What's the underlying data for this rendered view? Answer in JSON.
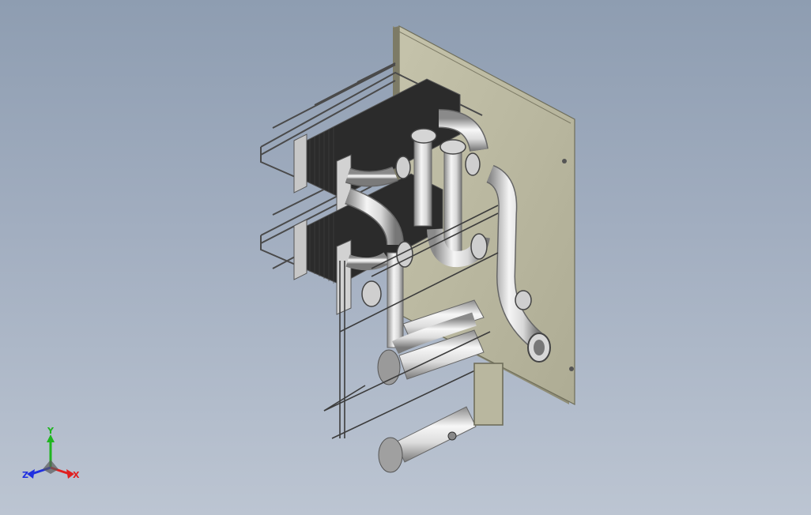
{
  "viewport": {
    "background_top": "#8e9db1",
    "background_bottom": "#bcc5d2"
  },
  "model": {
    "description_icon": "cad-assembly-heat-exchanger-skid",
    "plate_color": "#b9b79f",
    "plate_edge_color": "#8b8a72",
    "stack_color": "#2a2a2a",
    "pipe_light": "#f4f4f4",
    "pipe_dark": "#8f8f8f",
    "frame_color": "#c9c9c9"
  },
  "triad": {
    "x_label": "X",
    "y_label": "Y",
    "z_label": "Z",
    "x_color": "#e02020",
    "y_color": "#1fb51f",
    "z_color": "#2030e0"
  }
}
